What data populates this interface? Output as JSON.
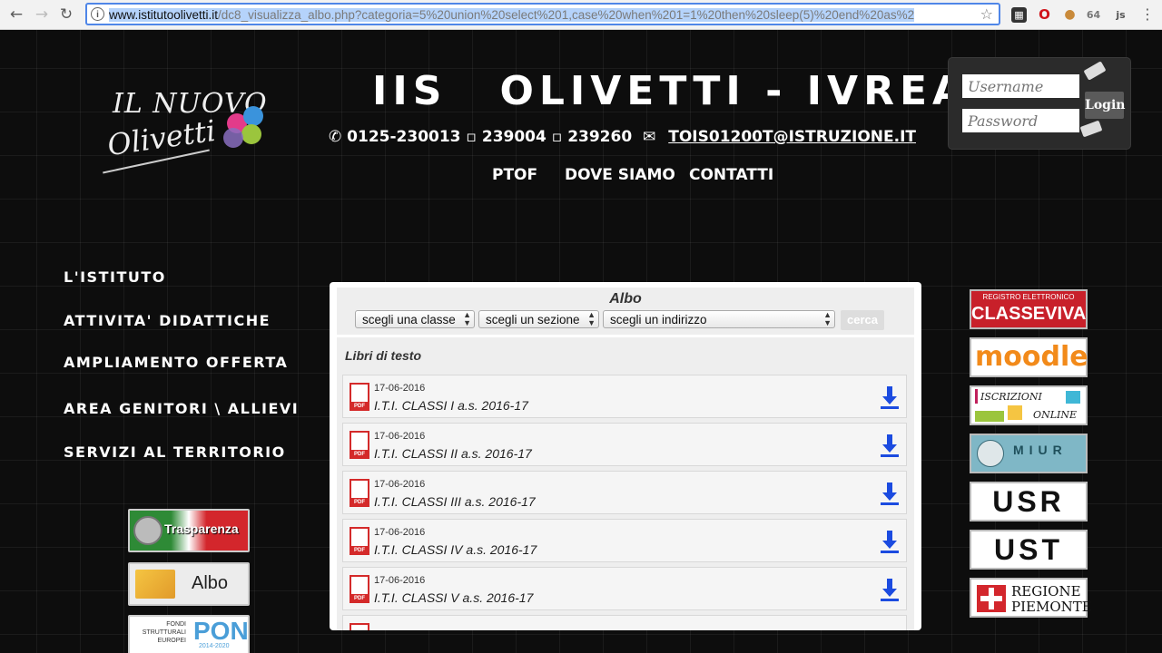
{
  "browser": {
    "back": "←",
    "forward": "→",
    "reload": "↻",
    "url_host": "www.istitutoolivetti.it",
    "url_path": "/dc8_visualizza_albo.php?categoria=5%20union%20select%201,case%20when%201=1%20then%20sleep(5)%20end%20as%2",
    "info": "i",
    "bookmark": "☆",
    "extensions": [
      "tab-icon",
      "opera-icon",
      "cookie-icon",
      "64",
      "js"
    ]
  },
  "site": {
    "logo_il": "IL NUOVO",
    "logo_oli": "Olivetti",
    "logo_dot_colors": [
      "#e33b8a",
      "#3a93dc",
      "#9bc53d",
      "#8a6fbf"
    ],
    "title_iis": "IIS",
    "title_main": "OLIVETTI - IVREA",
    "phone": "✆ 0125-230013 ▫ 239004 ▫ 239260",
    "mail_icon": "✉",
    "email": "TOIS01200T@ISTRUZIONE.IT",
    "topnav": [
      "PTOF",
      "DOVE SIAMO",
      "CONTATTI"
    ]
  },
  "login": {
    "username_placeholder": "Username",
    "password_placeholder": "Password",
    "button": "Login"
  },
  "left_menu": [
    "L'ISTITUTO",
    "ATTIVITA' DIDATTICHE",
    "AMPLIAMENTO OFFERTA",
    "AREA GENITORI \\ ALLIEVI",
    "SERVIZI AL TERRITORIO"
  ],
  "left_badges": {
    "trasparenza": "Trasparenza",
    "albo": "Albo",
    "pon_small": "FONDI STRUTTURALI EUROPEI",
    "pon": "PON",
    "pon_years": "2014-2020"
  },
  "albo": {
    "title": "Albo",
    "select_classe": "scegli una classe",
    "select_sezione": "scegli un sezione",
    "select_indirizzo": "scegli un indirizzo",
    "cerca": "cerca",
    "section_label": "Libri di testo",
    "rows": [
      {
        "date": "17-06-2016",
        "title": "I.T.I. CLASSI I a.s. 2016-17"
      },
      {
        "date": "17-06-2016",
        "title": "I.T.I. CLASSI II a.s. 2016-17"
      },
      {
        "date": "17-06-2016",
        "title": "I.T.I. CLASSI III a.s. 2016-17"
      },
      {
        "date": "17-06-2016",
        "title": "I.T.I. CLASSI IV a.s. 2016-17"
      },
      {
        "date": "17-06-2016",
        "title": "I.T.I. CLASSI V a.s. 2016-17"
      }
    ],
    "pdf_label": "PDF"
  },
  "right_badges": {
    "classeviva_top": "REGISTRO ELETTRONICO",
    "classeviva": "CLASSEVIVA",
    "moodle": "moodle",
    "iscrizioni": "ISCRIZIONI",
    "online": "ONLINE",
    "miur": "MIUR",
    "usr": "USR",
    "ust": "UST",
    "regione": "REGIONE",
    "piemonte": "PIEMONTE"
  }
}
